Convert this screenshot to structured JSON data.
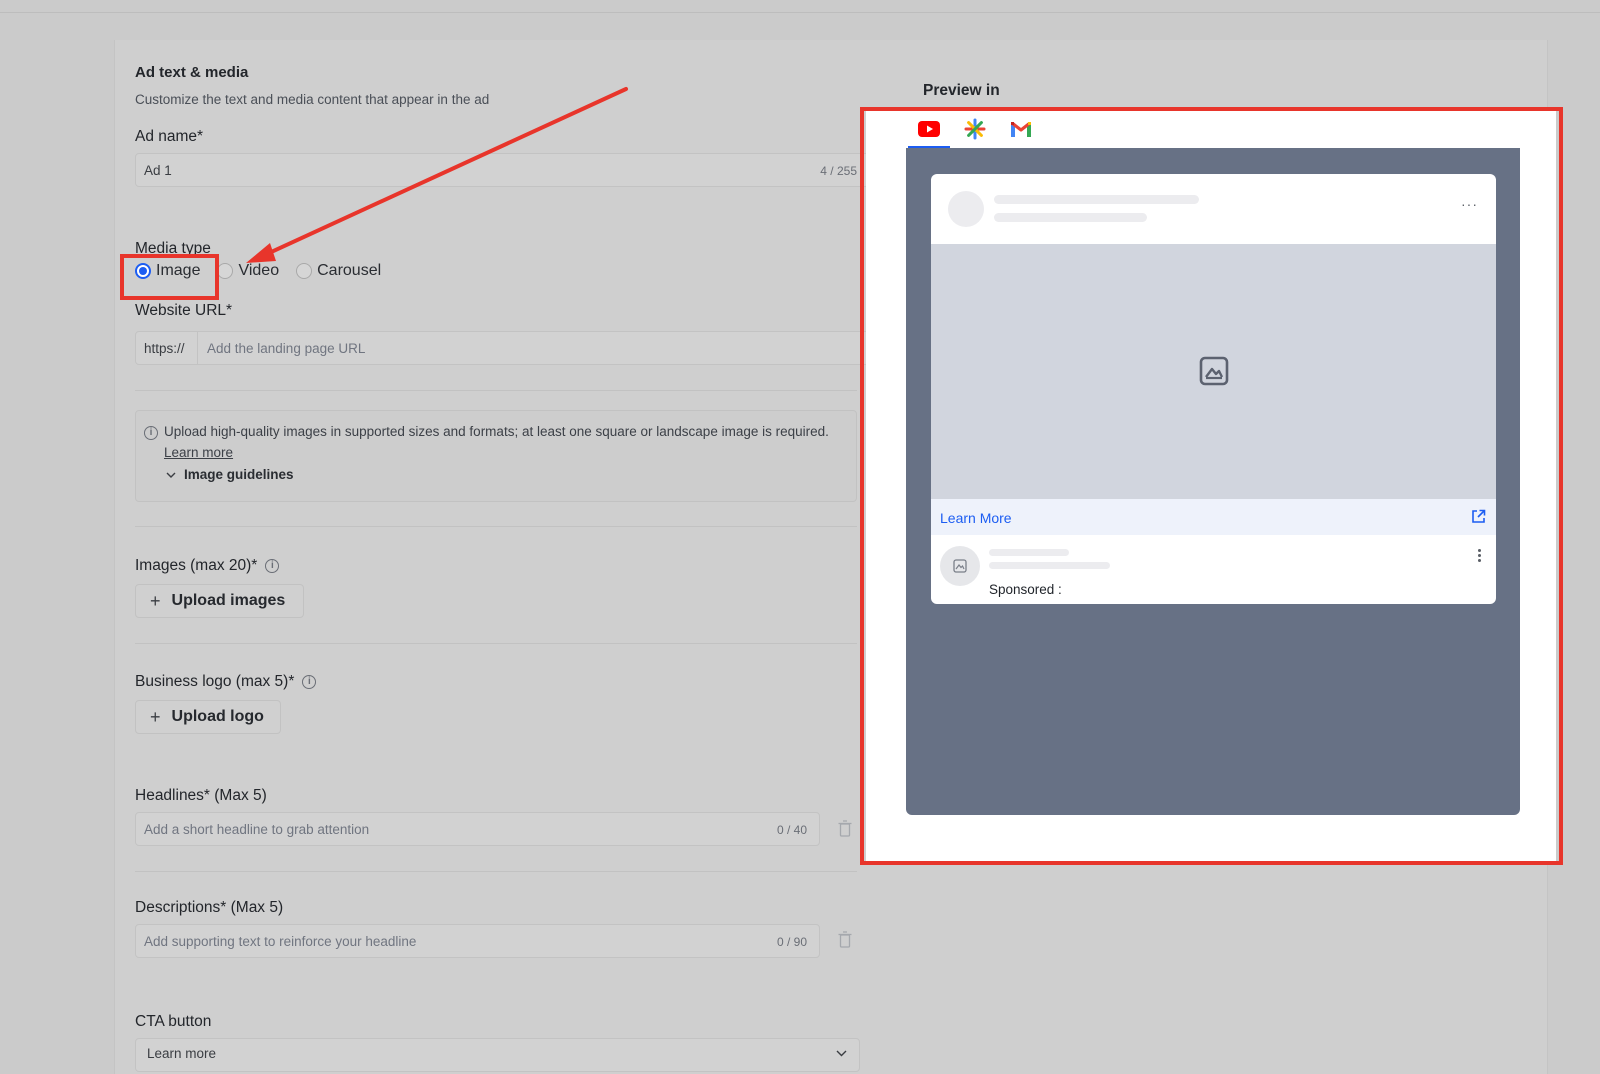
{
  "form": {
    "title": "Ad text & media",
    "subtitle": "Customize the text and media content that appear in the ad",
    "ad_name": {
      "label": "Ad name*",
      "value": "Ad 1",
      "counter": "4 / 255"
    },
    "media_type": {
      "label": "Media type",
      "options": [
        "Image",
        "Video",
        "Carousel"
      ],
      "selected": "Image"
    },
    "website_url": {
      "label": "Website URL*",
      "prefix": "https://",
      "placeholder": "Add the landing page URL"
    },
    "notice": {
      "text": "Upload high-quality images in supported sizes and formats; at least one square or landscape image is required.",
      "link": "Learn more",
      "guidelines": "Image guidelines"
    },
    "images": {
      "label": "Images (max 20)*",
      "button": "Upload images"
    },
    "business_logo": {
      "label": "Business logo (max 5)*",
      "button": "Upload logo"
    },
    "headlines": {
      "label": "Headlines* (Max 5)",
      "placeholder": "Add a short headline to grab attention",
      "counter": "0 / 40"
    },
    "descriptions": {
      "label": "Descriptions* (Max 5)",
      "placeholder": "Add supporting text to reinforce your headline",
      "counter": "0 / 90"
    },
    "cta": {
      "label": "CTA button",
      "value": "Learn more"
    }
  },
  "preview": {
    "title": "Preview in",
    "tabs": [
      {
        "name": "youtube-icon",
        "active": true
      },
      {
        "name": "google-discover-icon",
        "active": false
      },
      {
        "name": "gmail-icon",
        "active": false
      }
    ],
    "cta": "Learn More",
    "sponsored": "Sponsored :"
  },
  "colors": {
    "accent": "#1c5df2",
    "annotation_red": "#e8352b",
    "stage": "#677185"
  }
}
